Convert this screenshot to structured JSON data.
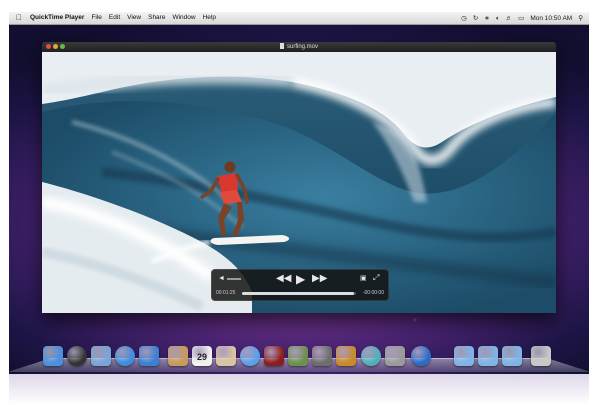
{
  "menubar": {
    "app_name": "QuickTime Player",
    "items": [
      "File",
      "Edit",
      "View",
      "Share",
      "Window",
      "Help"
    ],
    "clock": "Mon 10:50 AM",
    "status_icons": [
      "time-machine-icon",
      "sync-icon",
      "bluetooth-icon",
      "wifi-icon",
      "volume-icon",
      "battery-icon",
      "spotlight-icon"
    ]
  },
  "window": {
    "title": "surfing.mov"
  },
  "player": {
    "elapsed": "00:01:25",
    "remaining": "-00:00:00",
    "progress": 0.98
  },
  "dock": {
    "items": [
      {
        "name": "finder-icon",
        "color": "#4a8fe0"
      },
      {
        "name": "dashboard-icon",
        "color": "#333333"
      },
      {
        "name": "mail-icon",
        "color": "#7aa5d8"
      },
      {
        "name": "safari-icon",
        "color": "#3d8de0"
      },
      {
        "name": "ichat-icon",
        "color": "#3c7fd4"
      },
      {
        "name": "address-book-icon",
        "color": "#c89b5b"
      },
      {
        "name": "ical-icon",
        "color": "#f2f2f2",
        "text": "29"
      },
      {
        "name": "preview-icon",
        "color": "#d8c4a0"
      },
      {
        "name": "itunes-icon",
        "color": "#5aa0e8"
      },
      {
        "name": "photo-booth-icon",
        "color": "#8a1e1e"
      },
      {
        "name": "iphoto-icon",
        "color": "#6f8f50"
      },
      {
        "name": "imovie-icon",
        "color": "#6d6d6d"
      },
      {
        "name": "garageband-icon",
        "color": "#c98a2b"
      },
      {
        "name": "time-machine-icon",
        "color": "#4fb0b8"
      },
      {
        "name": "system-preferences-icon",
        "color": "#9a9a9a"
      },
      {
        "name": "quicktime-icon",
        "color": "#2a6cc8"
      },
      {
        "name": "applications-folder-icon",
        "color": "#7fb4e6"
      },
      {
        "name": "documents-folder-icon",
        "color": "#7fb4e6"
      },
      {
        "name": "downloads-folder-icon",
        "color": "#7fb4e6"
      },
      {
        "name": "trash-icon",
        "color": "#c8c8c8"
      }
    ]
  }
}
